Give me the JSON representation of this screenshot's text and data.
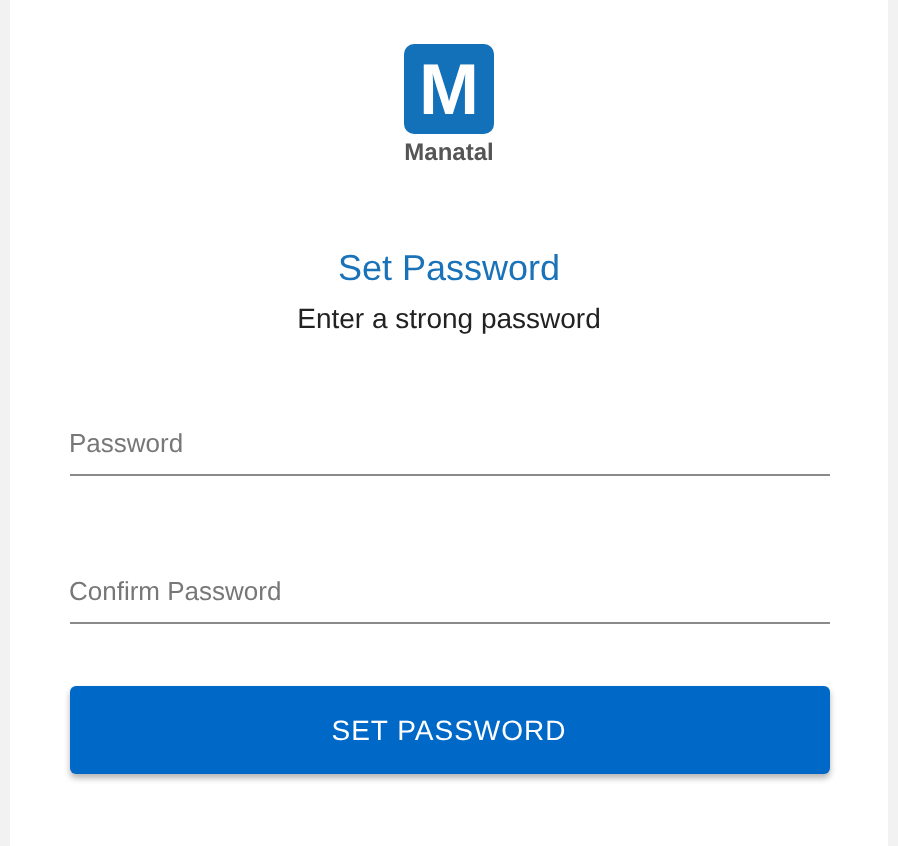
{
  "logo": {
    "mark": "M",
    "name": "Manatal"
  },
  "title": "Set Password",
  "subtitle": "Enter a strong password",
  "fields": [
    {
      "placeholder": "Password"
    },
    {
      "placeholder": "Confirm Password"
    }
  ],
  "button": "SET PASSWORD"
}
